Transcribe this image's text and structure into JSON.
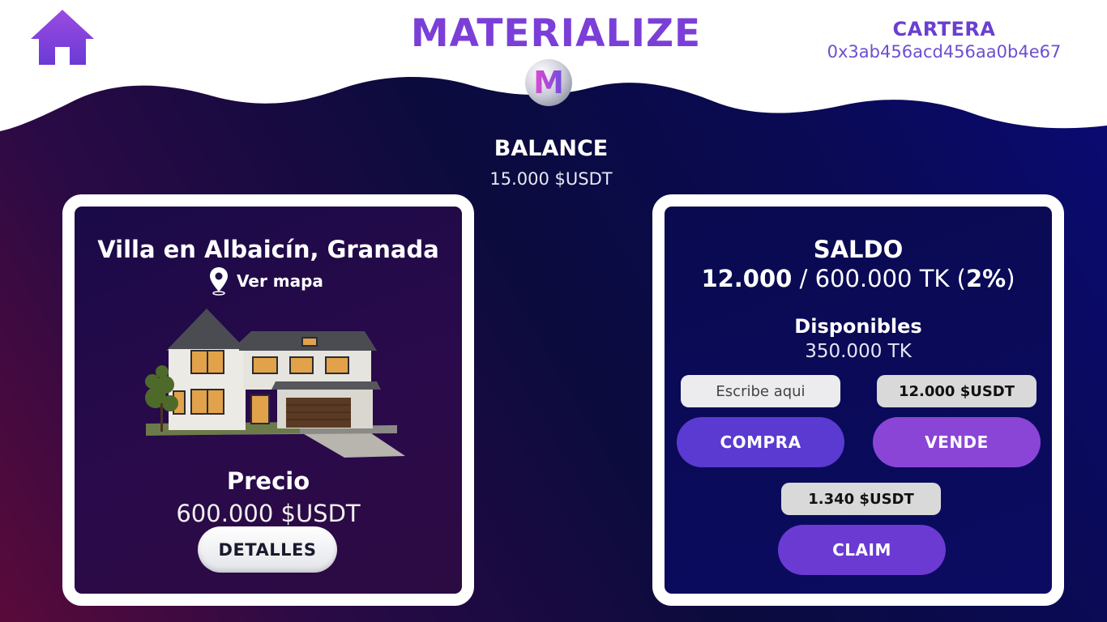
{
  "header": {
    "brand": "MATERIALIZE",
    "logo_letter": "M",
    "wallet_label": "CARTERA",
    "wallet_address": "0x3ab456acd456aa0b4e67",
    "home_icon": "home-icon"
  },
  "balance": {
    "label": "BALANCE",
    "value": "15.000 $USDT"
  },
  "property": {
    "title": "Villa en Albaicín, Granada",
    "map_label": "Ver mapa",
    "map_icon": "map-pin-icon",
    "price_label": "Precio",
    "price_value": "600.000 $USDT",
    "details_label": "DETALLES"
  },
  "holdings": {
    "saldo_label": "SALDO",
    "owned": "12.000",
    "separator": " / ",
    "total": "600.000 TK (",
    "percent": "2%",
    "close_paren": ")",
    "available_label": "Disponibles",
    "available_value": "350.000 TK",
    "input_placeholder": "Escribe aqui",
    "input_value": "",
    "quote_value": "12.000 $USDT",
    "buy_label": "COMPRA",
    "sell_label": "VENDE",
    "claim_amount": "1.340 $USDT",
    "claim_label": "CLAIM"
  },
  "colors": {
    "brand_purple": "#7b3fd8",
    "wave_white": "#ffffff",
    "buy_button": "#5a3ad0",
    "sell_button": "#8a45d6",
    "claim_button": "#6a3ad2"
  }
}
